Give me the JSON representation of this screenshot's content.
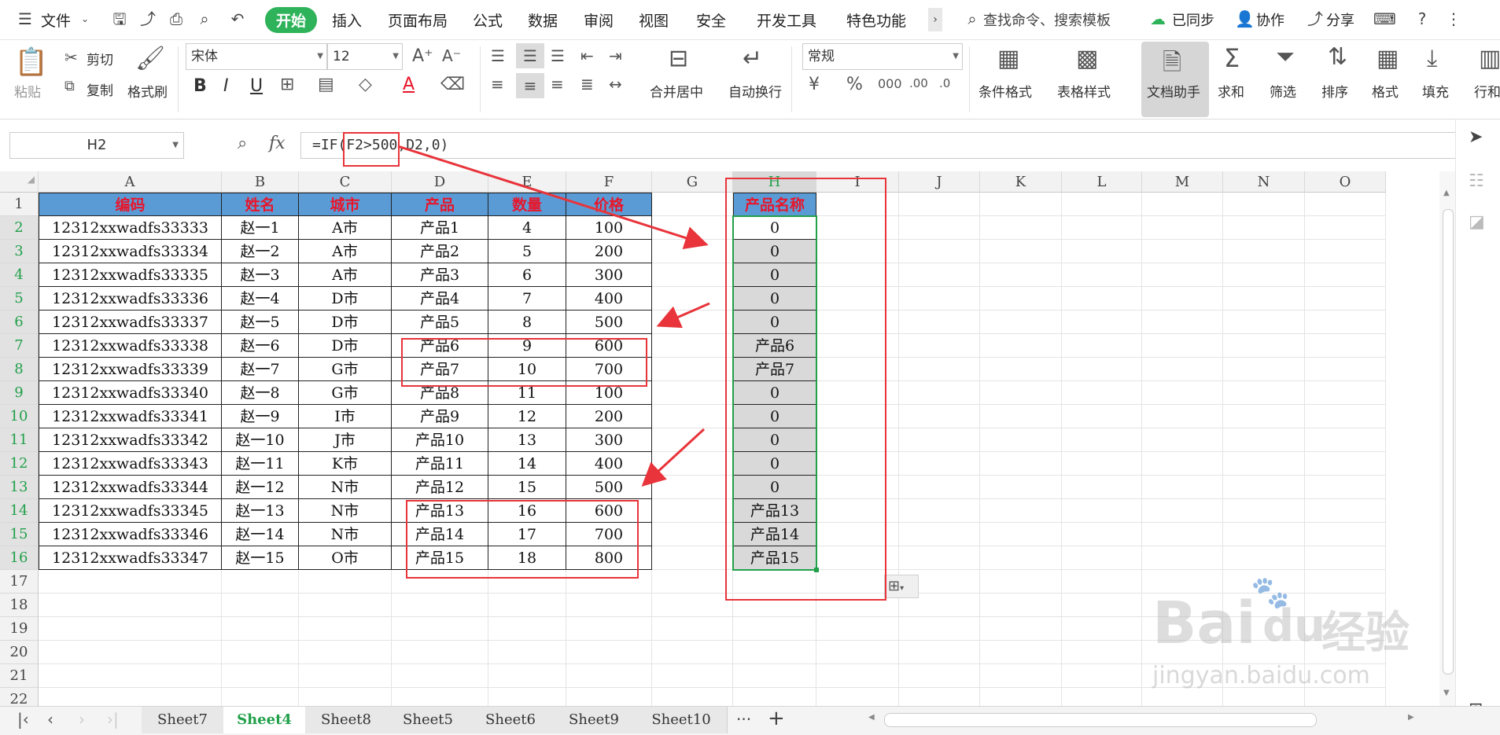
{
  "menubar": {
    "file_label": "文件",
    "tabs": [
      "开始",
      "插入",
      "页面布局",
      "公式",
      "数据",
      "审阅",
      "视图",
      "安全",
      "开发工具",
      "特色功能"
    ],
    "active_tab": "开始",
    "search_placeholder": "查找命令、搜索模板",
    "sync_label": "已同步",
    "collab_label": "协作",
    "share_label": "分享"
  },
  "ribbon": {
    "paste": "粘贴",
    "cut": "剪切",
    "copy": "复制",
    "format_painter": "格式刷",
    "font_name": "宋体",
    "font_size": "12",
    "merge_center": "合并居中",
    "wrap_text": "自动换行",
    "number_format": "常规",
    "conditional_format": "条件格式",
    "table_style": "表格样式",
    "doc_assistant": "文档助手",
    "sum": "求和",
    "filter": "筛选",
    "sort": "排序",
    "format": "格式",
    "fill": "填充",
    "row_col": "行和"
  },
  "formula_bar": {
    "name_box": "H2",
    "fx": "fx",
    "formula": "=IF(F2>500,D2,0)"
  },
  "grid": {
    "columns": [
      "A",
      "B",
      "C",
      "D",
      "E",
      "F",
      "G",
      "H",
      "I",
      "J",
      "K",
      "L",
      "M",
      "N",
      "O"
    ],
    "rows": [
      "1",
      "2",
      "3",
      "4",
      "5",
      "6",
      "7",
      "8",
      "9",
      "10",
      "11",
      "12",
      "13",
      "14",
      "15",
      "16",
      "17",
      "18",
      "19",
      "20",
      "21",
      "22"
    ],
    "headers": [
      "编码",
      "姓名",
      "城市",
      "产品",
      "数量",
      "价格"
    ],
    "data": [
      [
        "12312xxwadfs33333",
        "赵一1",
        "A市",
        "产品1",
        "4",
        "100"
      ],
      [
        "12312xxwadfs33334",
        "赵一2",
        "A市",
        "产品2",
        "5",
        "200"
      ],
      [
        "12312xxwadfs33335",
        "赵一3",
        "A市",
        "产品3",
        "6",
        "300"
      ],
      [
        "12312xxwadfs33336",
        "赵一4",
        "D市",
        "产品4",
        "7",
        "400"
      ],
      [
        "12312xxwadfs33337",
        "赵一5",
        "D市",
        "产品5",
        "8",
        "500"
      ],
      [
        "12312xxwadfs33338",
        "赵一6",
        "D市",
        "产品6",
        "9",
        "600"
      ],
      [
        "12312xxwadfs33339",
        "赵一7",
        "G市",
        "产品7",
        "10",
        "700"
      ],
      [
        "12312xxwadfs33340",
        "赵一8",
        "G市",
        "产品8",
        "11",
        "100"
      ],
      [
        "12312xxwadfs33341",
        "赵一9",
        "I市",
        "产品9",
        "12",
        "200"
      ],
      [
        "12312xxwadfs33342",
        "赵一10",
        "J市",
        "产品10",
        "13",
        "300"
      ],
      [
        "12312xxwadfs33343",
        "赵一11",
        "K市",
        "产品11",
        "14",
        "400"
      ],
      [
        "12312xxwadfs33344",
        "赵一12",
        "N市",
        "产品12",
        "15",
        "500"
      ],
      [
        "12312xxwadfs33345",
        "赵一13",
        "N市",
        "产品13",
        "16",
        "600"
      ],
      [
        "12312xxwadfs33346",
        "赵一14",
        "N市",
        "产品14",
        "17",
        "700"
      ],
      [
        "12312xxwadfs33347",
        "赵一15",
        "O市",
        "产品15",
        "18",
        "800"
      ]
    ],
    "h_header": "产品名称",
    "h_values": [
      "0",
      "0",
      "0",
      "0",
      "0",
      "产品6",
      "产品7",
      "0",
      "0",
      "0",
      "0",
      "0",
      "产品13",
      "产品14",
      "产品15"
    ]
  },
  "sheets": {
    "tabs": [
      "Sheet7",
      "Sheet4",
      "Sheet8",
      "Sheet5",
      "Sheet6",
      "Sheet9",
      "Sheet10"
    ],
    "active": "Sheet4",
    "more": "···",
    "add": "+"
  },
  "watermark": {
    "brand": "Bai",
    "brand2": "du",
    "jingyan": "经验",
    "url": "jingyan.baidu.com"
  },
  "colors": {
    "accent": "#2fb35a",
    "header_fill": "#5b9bd5",
    "header_text": "#e8162b",
    "annotation": "#e8343a",
    "selection": "#21a04a"
  }
}
